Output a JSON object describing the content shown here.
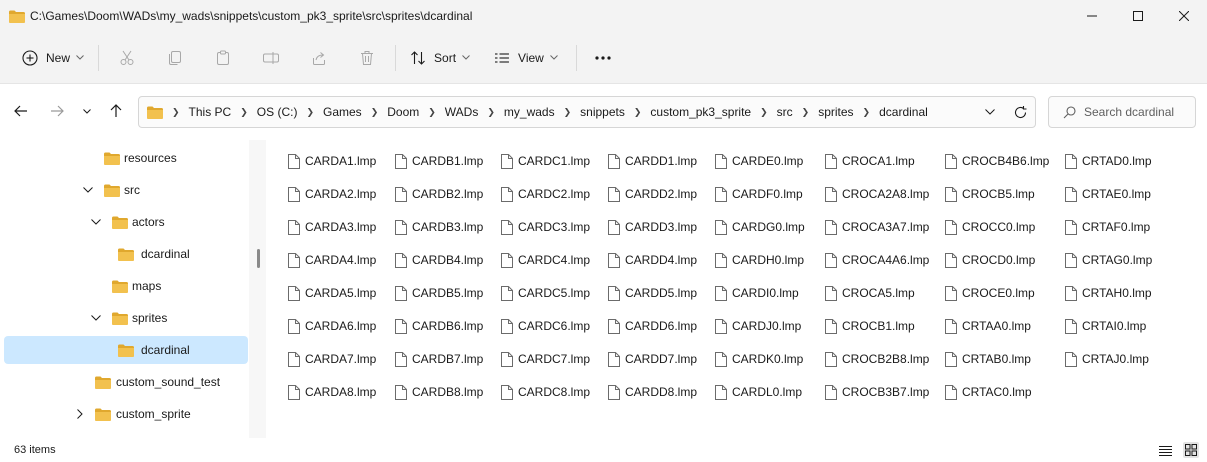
{
  "window": {
    "title": "C:\\Games\\Doom\\WADs\\my_wads\\snippets\\custom_pk3_sprite\\src\\sprites\\dcardinal"
  },
  "toolbar": {
    "new_label": "New",
    "sort_label": "Sort",
    "view_label": "View",
    "more_label": "···"
  },
  "address": {
    "crumbs": [
      "This PC",
      "OS (C:)",
      "Games",
      "Doom",
      "WADs",
      "my_wads",
      "snippets",
      "custom_pk3_sprite",
      "src",
      "sprites",
      "dcardinal"
    ]
  },
  "search": {
    "placeholder": "Search dcardinal"
  },
  "sidebar": {
    "items": [
      {
        "label": "resources",
        "expander": "none",
        "selected": false
      },
      {
        "label": "src",
        "expander": "expanded",
        "selected": false
      },
      {
        "label": "actors",
        "expander": "expanded",
        "selected": false
      },
      {
        "label": "dcardinal",
        "expander": "none",
        "selected": false
      },
      {
        "label": "maps",
        "expander": "none",
        "selected": false
      },
      {
        "label": "sprites",
        "expander": "expanded",
        "selected": false
      },
      {
        "label": "dcardinal",
        "expander": "none",
        "selected": true
      },
      {
        "label": "custom_sound_test",
        "expander": "none",
        "selected": false
      },
      {
        "label": "custom_sprite",
        "expander": "collapsed",
        "selected": false
      }
    ]
  },
  "files": {
    "columns": [
      [
        "CARDA1.lmp",
        "CARDA2.lmp",
        "CARDA3.lmp",
        "CARDA4.lmp",
        "CARDA5.lmp",
        "CARDA6.lmp",
        "CARDA7.lmp",
        "CARDA8.lmp"
      ],
      [
        "CARDB1.lmp",
        "CARDB2.lmp",
        "CARDB3.lmp",
        "CARDB4.lmp",
        "CARDB5.lmp",
        "CARDB6.lmp",
        "CARDB7.lmp",
        "CARDB8.lmp"
      ],
      [
        "CARDC1.lmp",
        "CARDC2.lmp",
        "CARDC3.lmp",
        "CARDC4.lmp",
        "CARDC5.lmp",
        "CARDC6.lmp",
        "CARDC7.lmp",
        "CARDC8.lmp"
      ],
      [
        "CARDD1.lmp",
        "CARDD2.lmp",
        "CARDD3.lmp",
        "CARDD4.lmp",
        "CARDD5.lmp",
        "CARDD6.lmp",
        "CARDD7.lmp",
        "CARDD8.lmp"
      ],
      [
        "CARDE0.lmp",
        "CARDF0.lmp",
        "CARDG0.lmp",
        "CARDH0.lmp",
        "CARDI0.lmp",
        "CARDJ0.lmp",
        "CARDK0.lmp",
        "CARDL0.lmp"
      ],
      [
        "CROCA1.lmp",
        "CROCA2A8.lmp",
        "CROCA3A7.lmp",
        "CROCA4A6.lmp",
        "CROCA5.lmp",
        "CROCB1.lmp",
        "CROCB2B8.lmp",
        "CROCB3B7.lmp"
      ],
      [
        "CROCB4B6.lmp",
        "CROCB5.lmp",
        "CROCC0.lmp",
        "CROCD0.lmp",
        "CROCE0.lmp",
        "CRTAA0.lmp",
        "CRTAB0.lmp",
        "CRTAC0.lmp"
      ],
      [
        "CRTAD0.lmp",
        "CRTAE0.lmp",
        "CRTAF0.lmp",
        "CRTAG0.lmp",
        "CRTAH0.lmp",
        "CRTAI0.lmp",
        "CRTAJ0.lmp"
      ]
    ]
  },
  "status": {
    "item_count": "63 items"
  },
  "colors": {
    "folder": "#f2c14e",
    "folder_dark": "#e0a82e",
    "selection": "#cce8ff",
    "chrome": "#f3f3f3"
  }
}
